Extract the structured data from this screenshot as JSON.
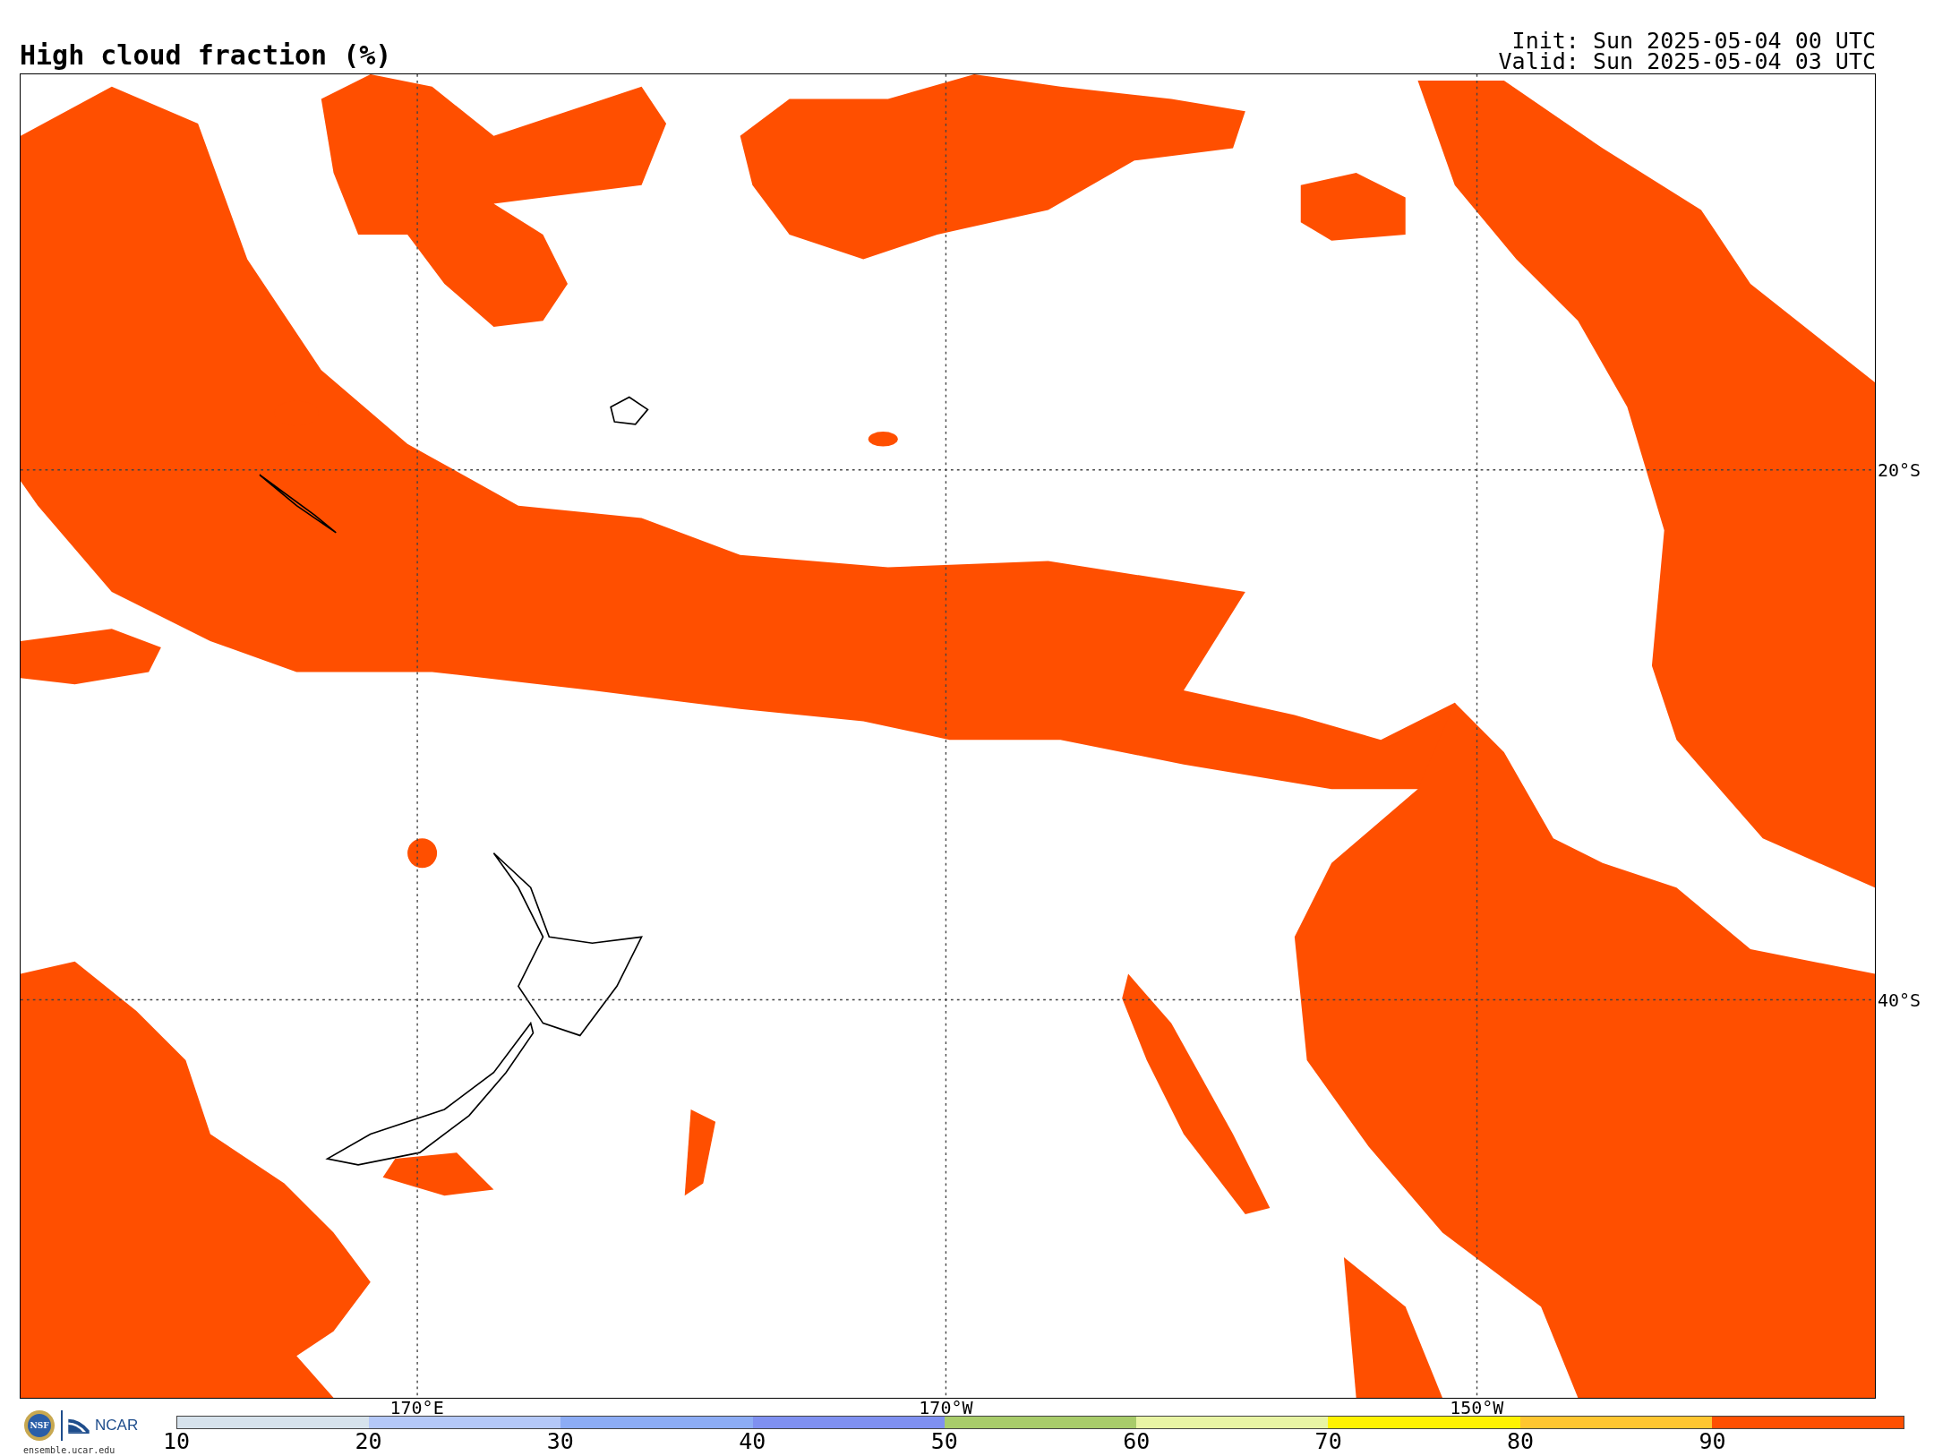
{
  "title": "High cloud fraction (%)",
  "init": "Init: Sun 2025-05-04 00 UTC",
  "valid": "Valid: Sun 2025-05-04 03 UTC",
  "map": {
    "longitude_labels": [
      "170°E",
      "170°W",
      "150°W"
    ],
    "latitude_labels": [
      "20°S",
      "40°S"
    ]
  },
  "logo": {
    "seal": "NSF",
    "wordmark": "NCAR",
    "url": "ensemble.ucar.edu"
  },
  "colorbar": {
    "bins": [
      {
        "color": "#d6e2ec"
      },
      {
        "color": "#b4c8f8"
      },
      {
        "color": "#8cacf4"
      },
      {
        "color": "#7f90f0"
      },
      {
        "color": "#a8cc6a"
      },
      {
        "color": "#e8f4a4"
      },
      {
        "color": "#fff200"
      },
      {
        "color": "#ffc630"
      },
      {
        "color": "#ff4f00"
      }
    ],
    "ticks": [
      "10",
      "20",
      "30",
      "40",
      "50",
      "60",
      "70",
      "80",
      "90"
    ]
  }
}
